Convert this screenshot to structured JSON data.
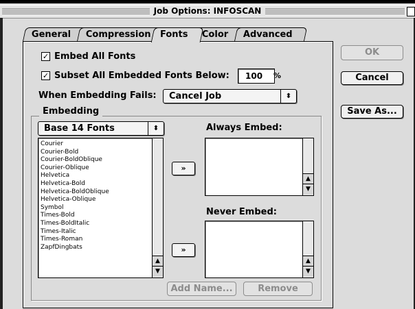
{
  "window": {
    "title": "Job Options: INFOSCAN"
  },
  "tabs": [
    {
      "label": "General"
    },
    {
      "label": "Compression"
    },
    {
      "label": "Fonts"
    },
    {
      "label": "Color"
    },
    {
      "label": "Advanced"
    }
  ],
  "active_tab": "Fonts",
  "options": {
    "embed_all": {
      "label": "Embed All Fonts",
      "checked": true
    },
    "subset": {
      "label": "Subset All Embedded Fonts Below:",
      "checked": true,
      "value": "100",
      "unit": "%"
    },
    "when_fails": {
      "label": "When Embedding Fails:",
      "value": "Cancel Job"
    }
  },
  "embedding": {
    "group_label": "Embedding",
    "source_popup": "Base 14 Fonts",
    "fonts": [
      "Courier",
      "Courier-Bold",
      "Courier-BoldOblique",
      "Courier-Oblique",
      "Helvetica",
      "Helvetica-Bold",
      "Helvetica-BoldOblique",
      "Helvetica-Oblique",
      "Symbol",
      "Times-Bold",
      "Times-BoldItalic",
      "Times-Italic",
      "Times-Roman",
      "ZapfDingbats"
    ],
    "always_embed_label": "Always Embed:",
    "never_embed_label": "Never Embed:",
    "move_symbol": "»",
    "add_name": "Add Name...",
    "remove": "Remove"
  },
  "buttons": {
    "ok": "OK",
    "cancel": "Cancel",
    "save_as": "Save As..."
  },
  "icons": {
    "check": "✓",
    "updown": "⬍",
    "scroll_up": "▲",
    "scroll_down": "▼"
  }
}
